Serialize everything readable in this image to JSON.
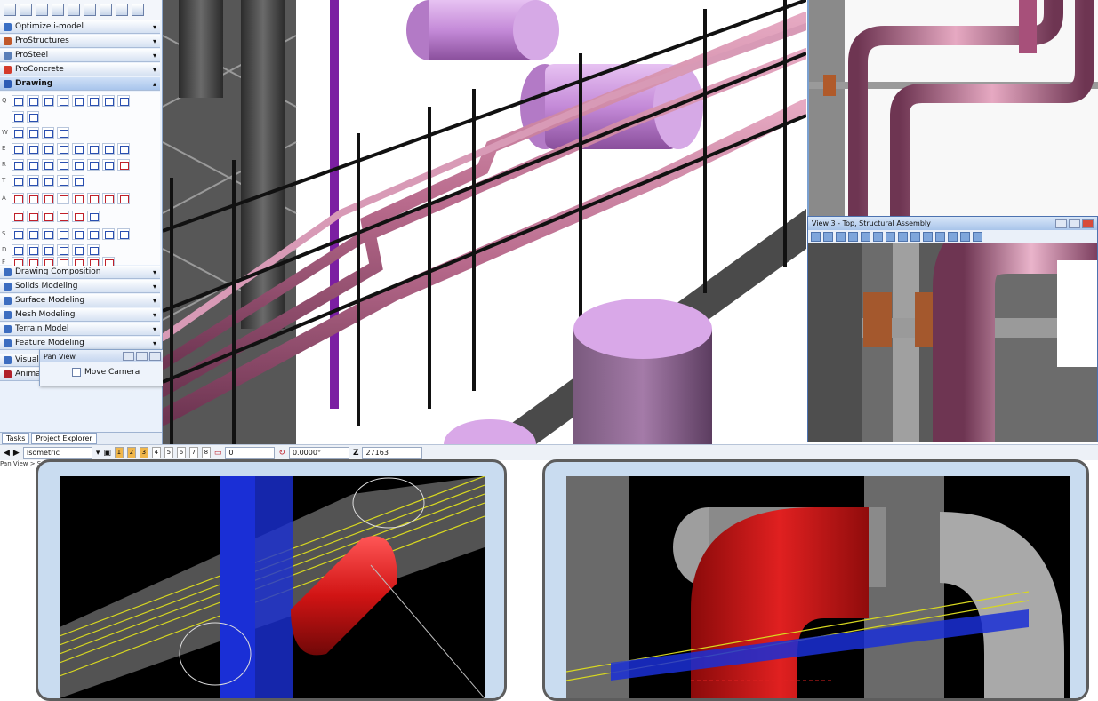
{
  "task_panel": {
    "sections_top": [
      {
        "label": "Optimize i-model",
        "color": "#3a6fc4"
      },
      {
        "label": "ProStructures",
        "color": "#c0582a"
      },
      {
        "label": "ProSteel",
        "color": "#5a7fb8"
      },
      {
        "label": "ProConcrete",
        "color": "#d43a2a"
      }
    ],
    "active_section": {
      "label": "Drawing",
      "color": "#2b5bb5"
    },
    "tool_row_letters": [
      "Q",
      "W",
      "E",
      "R",
      "T",
      "A",
      "S",
      "D",
      "F"
    ],
    "sections_bottom": [
      {
        "label": "Drawing Composition",
        "color": "#3c6dc0"
      },
      {
        "label": "Solids Modeling",
        "color": "#3c6dc0"
      },
      {
        "label": "Surface Modeling",
        "color": "#3c6dc0"
      },
      {
        "label": "Mesh Modeling",
        "color": "#3c6dc0"
      },
      {
        "label": "Terrain Model",
        "color": "#3c6dc0"
      },
      {
        "label": "Feature Modeling",
        "color": "#3c6dc0"
      },
      {
        "label": "Visualiz",
        "color": "#3c6dc0"
      },
      {
        "label": "Animat",
        "color": "#b0202a"
      }
    ],
    "tabs": [
      "Tasks",
      "Project Explorer"
    ]
  },
  "pan_view": {
    "title": "Pan View",
    "option": "Move Camera"
  },
  "view3": {
    "title": "View 3 - Top, Structural Assembly"
  },
  "statusbar": {
    "view_name": "Isometric",
    "view_numbers": [
      "1",
      "2",
      "3",
      "4",
      "5",
      "6",
      "7",
      "8"
    ],
    "active_views": [
      "1",
      "2",
      "3"
    ],
    "x_value": "0",
    "angle_value": "0.0000°",
    "z_label": "Z",
    "z_value": "27163"
  },
  "breadcrumb": "Pan View > S",
  "colors": {
    "pipe": "#b86a8c",
    "tank": "#c48ad8",
    "steel": "#1e1e1e",
    "highlight_red": "#d11414",
    "beam_blue": "#1a2fd6",
    "accent_panel": "#c9dcf0"
  }
}
